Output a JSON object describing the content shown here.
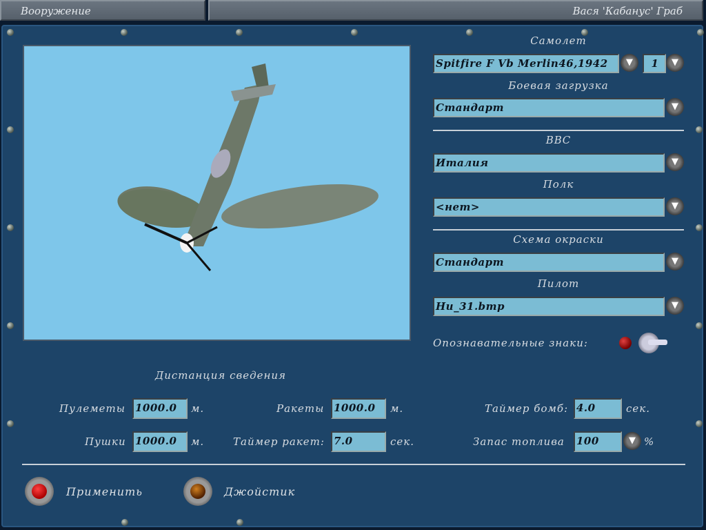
{
  "header": {
    "section_title": "Вооружение",
    "user_name": "Вася 'Кабанус' Граб"
  },
  "aircraft": {
    "label": "Самолет",
    "value": "Spitfire F Vb Merlin46,1942",
    "count": "1"
  },
  "loadout": {
    "label": "Боевая загрузка",
    "value": "Стандарт"
  },
  "air_force": {
    "label": "ВВС",
    "value": "Италия"
  },
  "regiment": {
    "label": "Полк",
    "value": "<нет>"
  },
  "skin": {
    "label": "Схема окраски",
    "value": "Стандарт"
  },
  "pilot": {
    "label": "Пилот",
    "value": "Hu_31.bmp"
  },
  "markings": {
    "label": "Опознавательные знаки:",
    "enabled": true
  },
  "convergence": {
    "title": "Дистанция сведения",
    "mg": {
      "label": "Пулеметы",
      "value": "1000.0",
      "unit": "м."
    },
    "cannon": {
      "label": "Пушки",
      "value": "1000.0",
      "unit": "м."
    },
    "rockets": {
      "label": "Ракеты",
      "value": "1000.0",
      "unit": "м."
    },
    "rocket_timer": {
      "label": "Таймер ракет:",
      "value": "7.0",
      "unit": "сек."
    },
    "bomb_timer": {
      "label": "Таймер бомб:",
      "value": "4.0",
      "unit": "сек."
    },
    "fuel": {
      "label": "Запас топлива",
      "value": "100",
      "unit": "%"
    }
  },
  "buttons": {
    "apply": "Применить",
    "joystick": "Джойстик"
  },
  "icons": {
    "dropdown": "▼"
  }
}
